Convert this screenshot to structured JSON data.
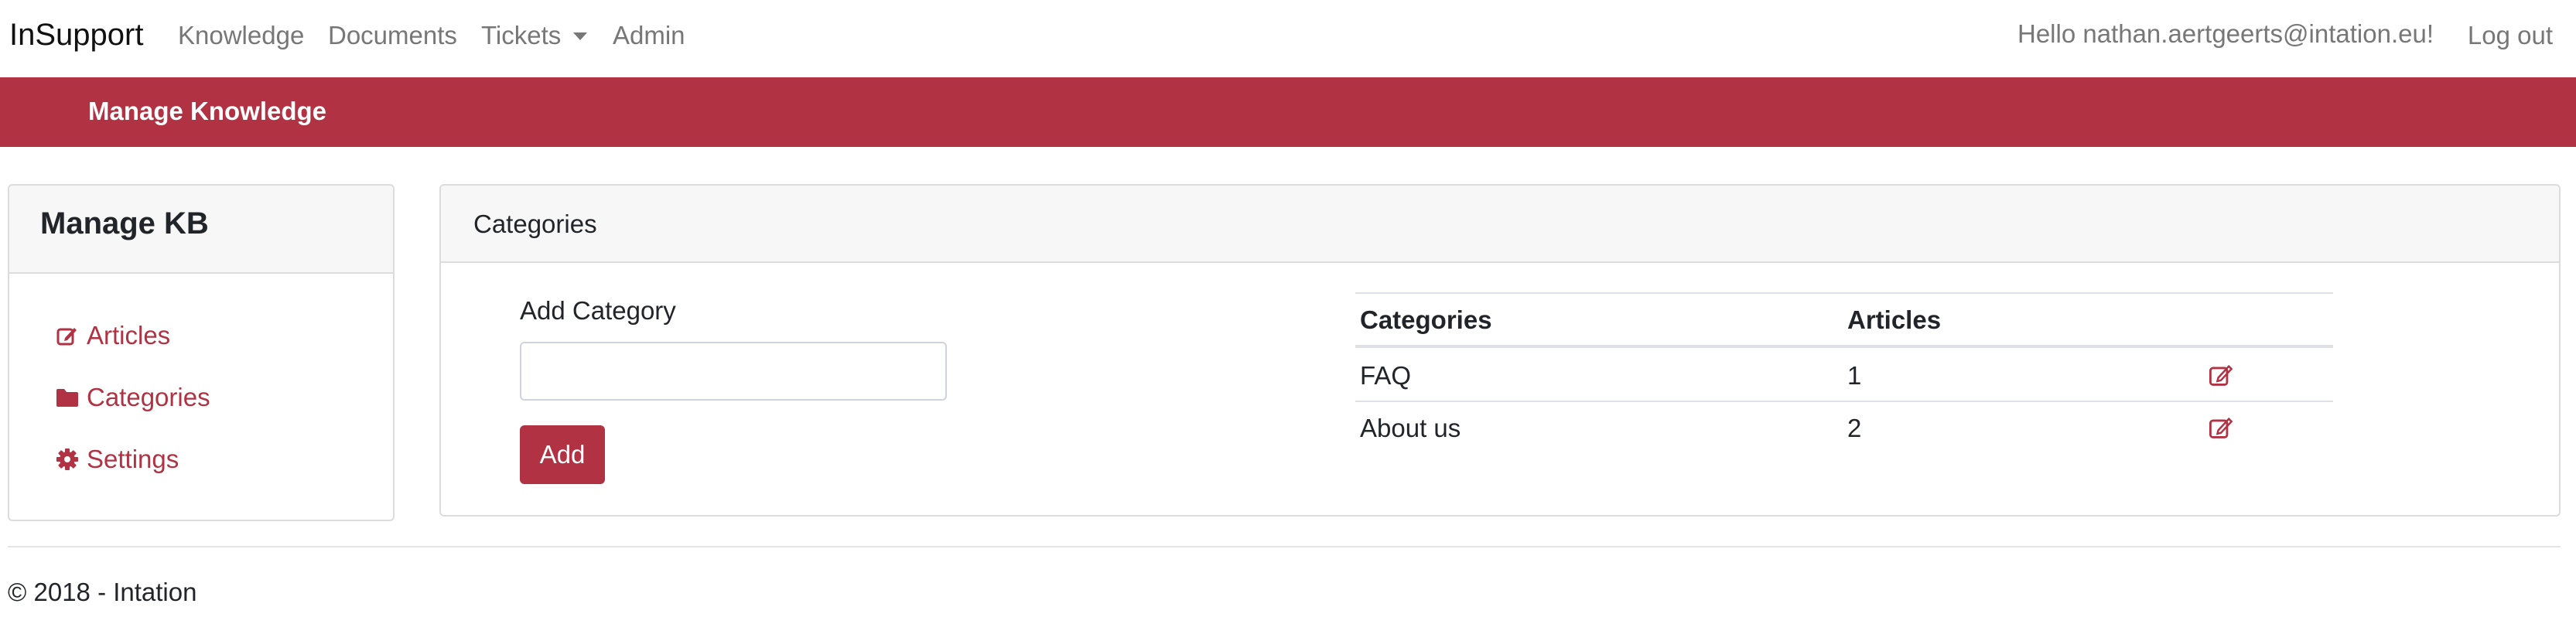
{
  "navbar": {
    "brand": "InSupport",
    "links": {
      "knowledge": "Knowledge",
      "documents": "Documents",
      "tickets": "Tickets",
      "admin": "Admin"
    },
    "greeting": "Hello nathan.aertgeerts@intation.eu!",
    "logout": "Log out"
  },
  "banner": {
    "title": "Manage Knowledge",
    "color": "#b03243"
  },
  "sidebar": {
    "title": "Manage KB",
    "items": [
      {
        "label": "Articles",
        "icon": "edit-icon"
      },
      {
        "label": "Categories",
        "icon": "folder-icon"
      },
      {
        "label": "Settings",
        "icon": "gear-icon"
      }
    ]
  },
  "main": {
    "header": "Categories",
    "form": {
      "label": "Add Category",
      "input_value": "",
      "button": "Add"
    },
    "table": {
      "columns": [
        "Categories",
        "Articles"
      ],
      "rows": [
        {
          "category": "FAQ",
          "articles": "1",
          "action_icon": "edit-icon"
        },
        {
          "category": "About us",
          "articles": "2",
          "action_icon": "edit-icon"
        }
      ]
    }
  },
  "footer": {
    "text": "© 2018 - Intation"
  },
  "colors": {
    "accent": "#b03243",
    "nav_text": "#777777"
  }
}
